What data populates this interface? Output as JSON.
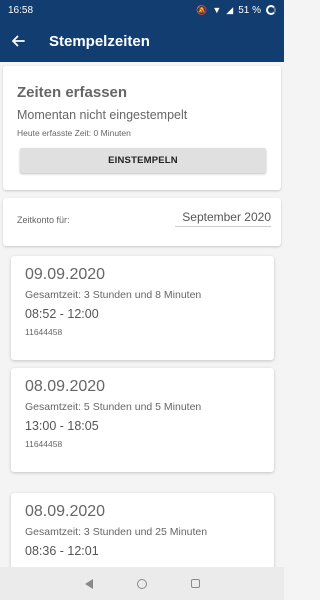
{
  "status": {
    "time": "16:58",
    "battery": "51 %"
  },
  "appbar": {
    "title": "Stempelzeiten"
  },
  "capture": {
    "heading": "Zeiten erfassen",
    "state": "Momentan nicht eingestempelt",
    "today": "Heute erfasste Zeit: 0 Minuten",
    "button_label": "EINSTEMPELN"
  },
  "account": {
    "label": "Zeitkonto für:",
    "selected_month": "September 2020"
  },
  "entries": [
    {
      "date": "09.09.2020",
      "total": "Gesamtzeit: 3 Stunden und 8 Minuten",
      "range": "08:52 - 12:00",
      "number": "11644458"
    },
    {
      "date": "08.09.2020",
      "total": "Gesamtzeit: 5 Stunden und 5 Minuten",
      "range": "13:00 - 18:05",
      "number": "11644458"
    },
    {
      "date": "08.09.2020",
      "total": "Gesamtzeit: 3 Stunden und 25 Minuten",
      "range": "08:36 - 12:01",
      "number": ""
    }
  ],
  "colors": {
    "primary": "#123d70",
    "button": "#e0e0e0"
  }
}
